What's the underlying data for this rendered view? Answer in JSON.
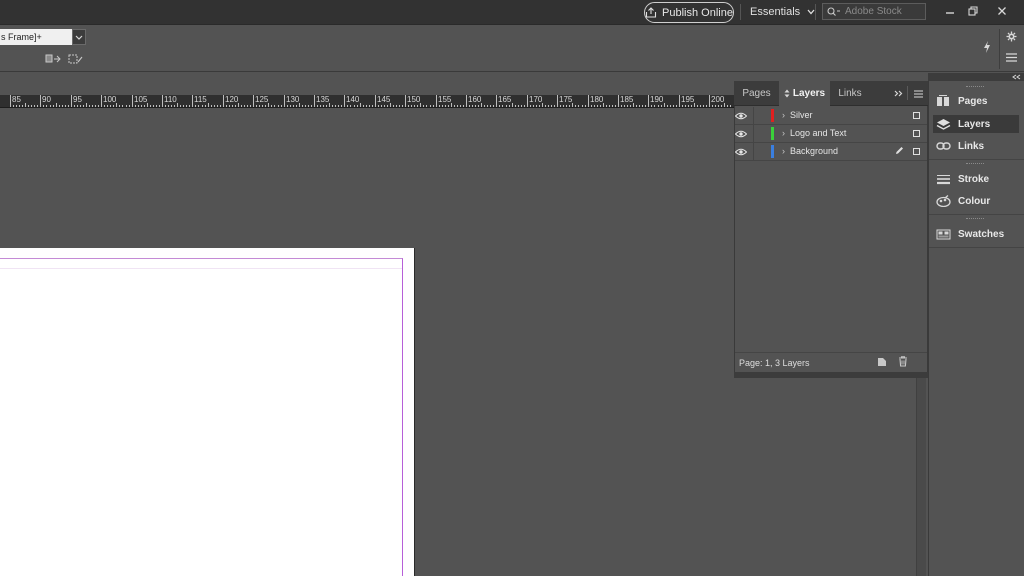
{
  "appbar": {
    "publish_label": "Publish Online",
    "workspace_label": "Essentials",
    "stock_search_placeholder": "Adobe Stock"
  },
  "controlbar": {
    "object_style_value": "s Frame]+"
  },
  "ruler": {
    "labels": [
      "85",
      "90",
      "95",
      "100",
      "105",
      "110",
      "115",
      "120",
      "125",
      "130",
      "135",
      "140",
      "145",
      "150",
      "155",
      "160",
      "165",
      "170",
      "175",
      "180",
      "185",
      "190",
      "195",
      "200"
    ]
  },
  "layers_panel": {
    "tabs": [
      {
        "label": "Pages"
      },
      {
        "label": "Layers"
      },
      {
        "label": "Links"
      }
    ],
    "layers": [
      {
        "name": "Silver",
        "color": "#e02020"
      },
      {
        "name": "Logo and Text",
        "color": "#3ad13a"
      },
      {
        "name": "Background",
        "color": "#3a7fe0"
      }
    ],
    "footer_text": "Page: 1, 3 Layers"
  },
  "dock": {
    "items": [
      {
        "label": "Pages",
        "icon": "pages-icon"
      },
      {
        "label": "Layers",
        "icon": "layers-icon"
      },
      {
        "label": "Links",
        "icon": "links-icon"
      },
      {
        "label": "Stroke",
        "icon": "stroke-icon"
      },
      {
        "label": "Colour",
        "icon": "colour-icon"
      },
      {
        "label": "Swatches",
        "icon": "swatches-icon"
      }
    ]
  }
}
